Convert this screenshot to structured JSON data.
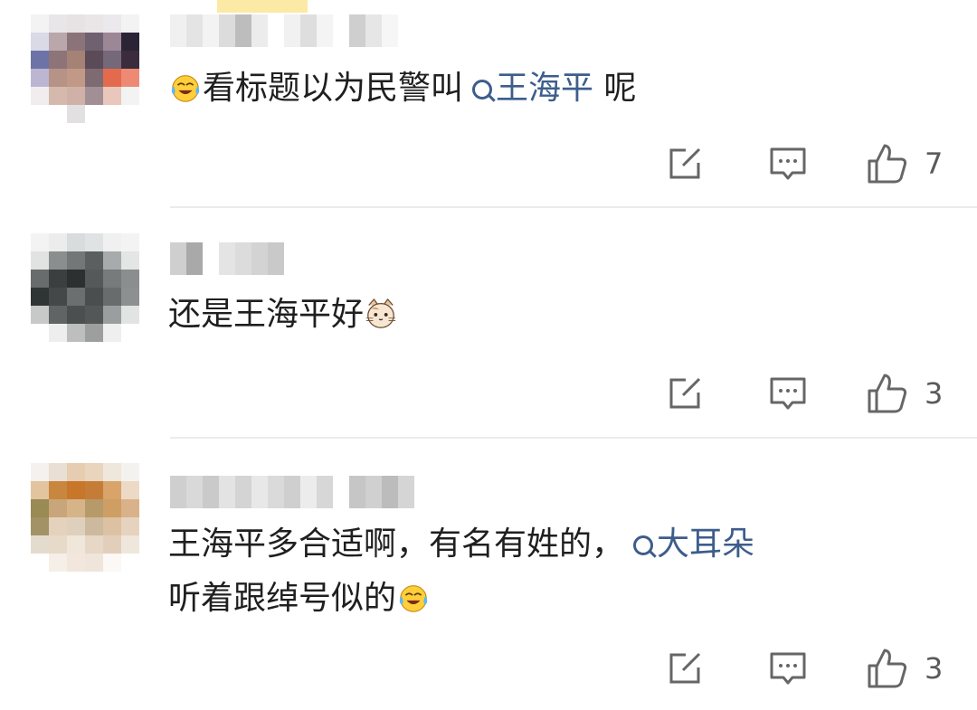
{
  "comments": [
    {
      "segments": [
        {
          "kind": "emoji",
          "icon": "laugh-cry-emoji-icon"
        },
        {
          "kind": "text",
          "value": "看标题以为民警叫"
        },
        {
          "kind": "topic",
          "value": "王海平"
        },
        {
          "kind": "text",
          "value": " 呢"
        }
      ],
      "likes": "7"
    },
    {
      "segments": [
        {
          "kind": "text",
          "value": "还是王海平好"
        },
        {
          "kind": "emoji",
          "icon": "cat-face-emoji-icon"
        }
      ],
      "likes": "3"
    },
    {
      "lines": [
        [
          {
            "kind": "text",
            "value": "王海平多合适啊，有名有姓的，"
          },
          {
            "kind": "topic",
            "value": "大耳朵"
          }
        ],
        [
          {
            "kind": "text",
            "value": "听着跟绰号似的"
          },
          {
            "kind": "emoji",
            "icon": "laugh-cry-emoji-icon"
          }
        ]
      ],
      "likes": "3"
    }
  ],
  "icons": {
    "share": "share-icon",
    "reply": "comment-icon",
    "like": "thumbs-up-icon"
  },
  "colors": {
    "topic": "#3d5d8c",
    "text": "#1f1f1f",
    "icon": "#666666",
    "divider": "#ececec"
  }
}
